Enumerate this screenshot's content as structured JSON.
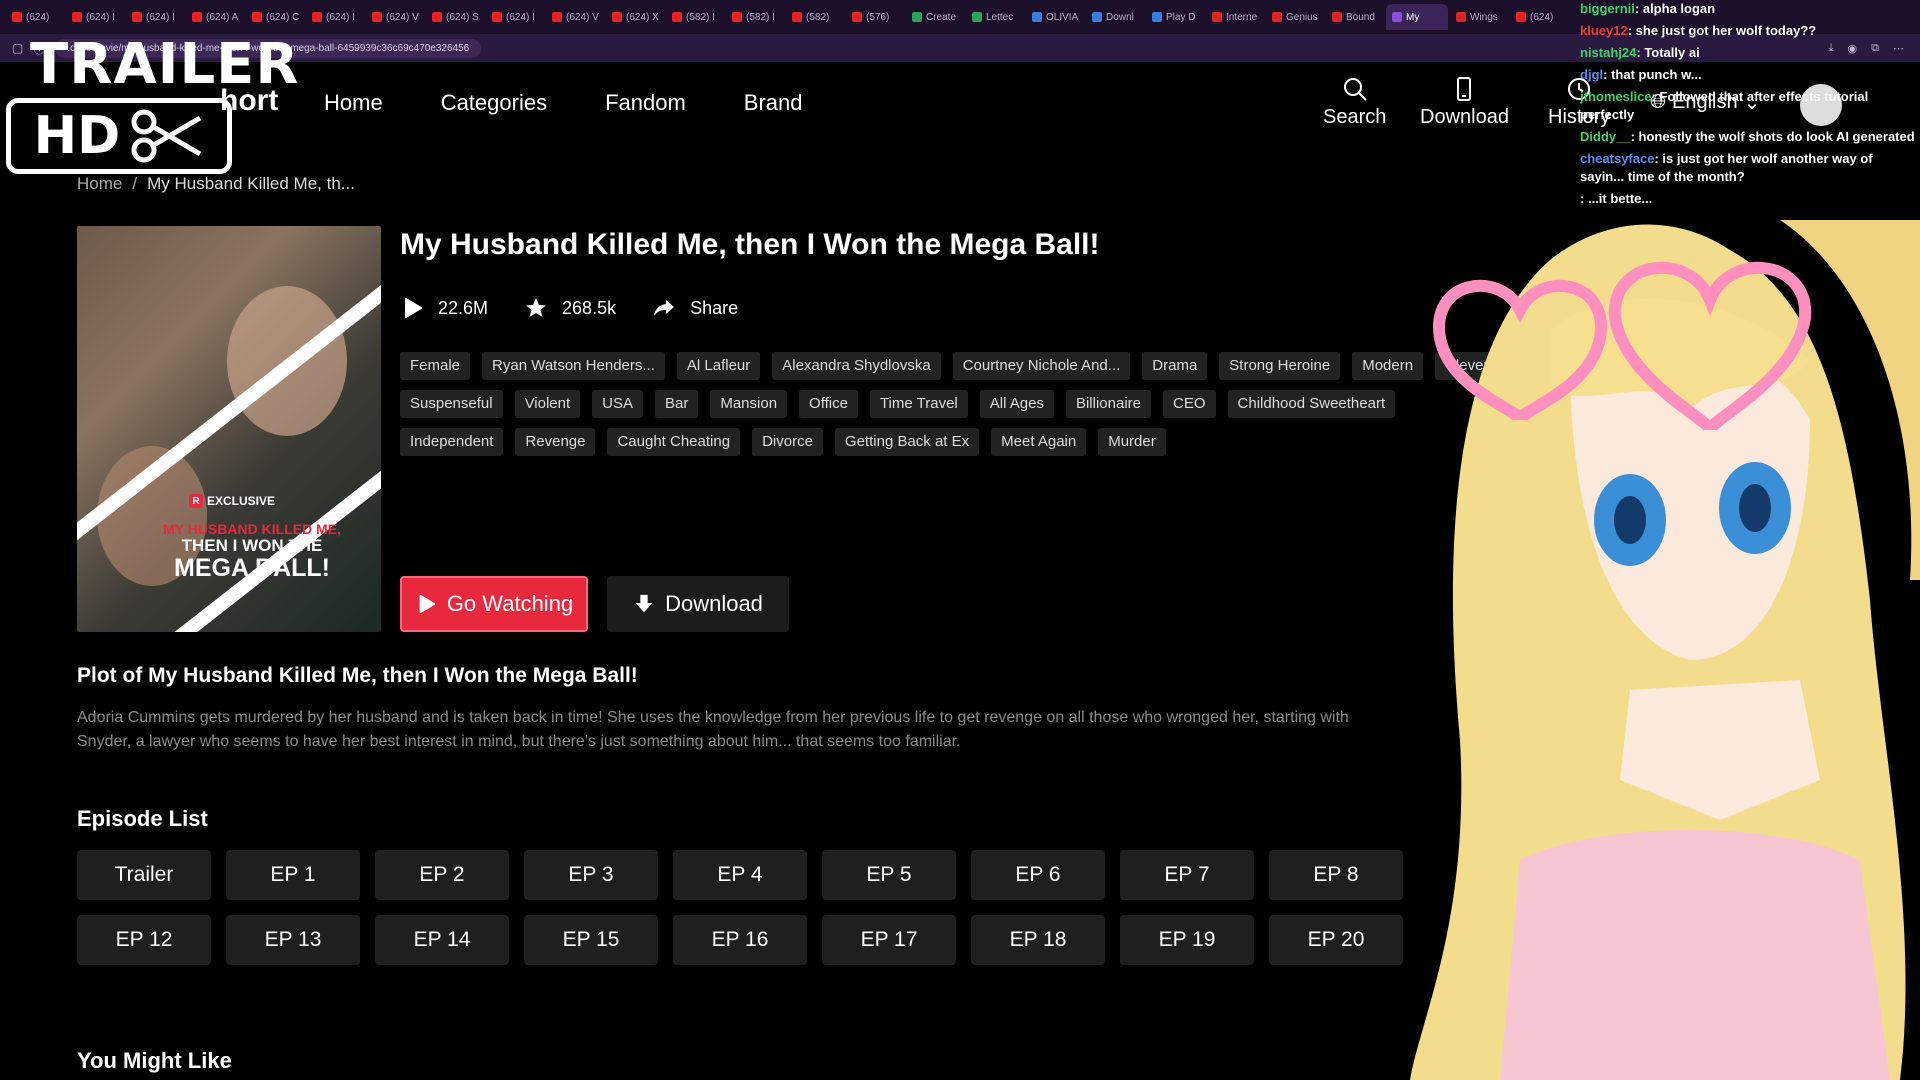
{
  "browser": {
    "tabs": [
      {
        "label": "(624) ",
        "favicon": "youtube",
        "active": false
      },
      {
        "label": "(624) I",
        "favicon": "youtube",
        "active": false
      },
      {
        "label": "(624) I",
        "favicon": "youtube",
        "active": false
      },
      {
        "label": "(624) A",
        "favicon": "youtube",
        "active": false
      },
      {
        "label": "(624) C",
        "favicon": "youtube",
        "active": false
      },
      {
        "label": "(624) I",
        "favicon": "youtube",
        "active": false
      },
      {
        "label": "(624) V",
        "favicon": "youtube",
        "active": false
      },
      {
        "label": "(624) S",
        "favicon": "youtube",
        "active": false
      },
      {
        "label": "(624) I",
        "favicon": "youtube",
        "active": false
      },
      {
        "label": "(624) V",
        "favicon": "youtube",
        "active": false
      },
      {
        "label": "(624) X",
        "favicon": "youtube",
        "active": false
      },
      {
        "label": "(582) I",
        "favicon": "youtube",
        "active": false
      },
      {
        "label": "(582) I",
        "favicon": "youtube",
        "active": false
      },
      {
        "label": "(582) ",
        "favicon": "youtube",
        "active": false
      },
      {
        "label": "(576) ",
        "favicon": "youtube",
        "active": false
      },
      {
        "label": "Create",
        "favicon": "green",
        "active": false
      },
      {
        "label": "Lettec",
        "favicon": "green",
        "active": false
      },
      {
        "label": "OLIVIA",
        "favicon": "blue",
        "active": false
      },
      {
        "label": "Downl",
        "favicon": "blue",
        "active": false
      },
      {
        "label": "Play D",
        "favicon": "blue",
        "active": false
      },
      {
        "label": "Interne",
        "favicon": "red2",
        "active": false
      },
      {
        "label": "Genius",
        "favicon": "red2",
        "active": false
      },
      {
        "label": "Bound",
        "favicon": "red2",
        "active": false
      },
      {
        "label": "My",
        "favicon": "purple",
        "active": true
      },
      {
        "label": "Wings",
        "favicon": "red2",
        "active": false
      },
      {
        "label": "(624)",
        "favicon": "youtube",
        "active": false
      }
    ],
    "url": ".com/movie/my-husband-killed-me-then-i-won-the-mega-ball-6459939c36c69c470e326456"
  },
  "logo": {
    "trailer": "TRAILER",
    "hd": "HD",
    "short": "hort"
  },
  "nav": {
    "home": "Home",
    "categories": "Categories",
    "fandom": "Fandom",
    "brand": "Brand"
  },
  "header_right": {
    "search": "Search",
    "download": "Download",
    "history": "History",
    "language": "English"
  },
  "breadcrumb": {
    "home": "Home",
    "separator": "/",
    "current": "My Husband Killed Me, th..."
  },
  "poster": {
    "badge": "EXCLUSIVE",
    "line1": "MY HUSBAND KILLED ME,",
    "line2": "THEN I WON THE",
    "line3": "MEGA BALL!"
  },
  "drama": {
    "title": "My Husband Killed Me, then I Won the Mega Ball!",
    "views": "22.6M",
    "favorites": "268.5k",
    "share": "Share",
    "tags": [
      "Female",
      "Ryan Watson Henders...",
      "Al Lafleur",
      "Alexandra Shydlovska",
      "Courtney Nichole And...",
      "Drama",
      "Strong Heroine",
      "Modern",
      "Clever",
      "Suspenseful",
      "Violent",
      "USA",
      "Bar",
      "Mansion",
      "Office",
      "Time Travel",
      "All Ages",
      "Billionaire",
      "CEO",
      "Childhood Sweetheart",
      "Independent",
      "Revenge",
      "Caught Cheating",
      "Divorce",
      "Getting Back at Ex",
      "Meet Again",
      "Murder"
    ],
    "watch_label": "Go Watching",
    "download_label": "Download",
    "plot_heading": "Plot of My Husband Killed Me, then I Won the Mega Ball!",
    "plot_line1": "Adoria Cummins gets murdered by her husband and is taken back in time! She uses the knowledge from her previous life to get revenge on all those who wronged her, starting with",
    "plot_line2": "Snyder, a lawyer who seems to have her best interest in mind, but there's just something about him... that seems too familiar."
  },
  "episodes": {
    "heading": "Episode List",
    "row1": [
      "Trailer",
      "EP 1",
      "EP 2",
      "EP 3",
      "EP 4",
      "EP 5",
      "EP 6",
      "EP 7",
      "EP 8"
    ],
    "row2": [
      "EP 12",
      "EP 13",
      "EP 14",
      "EP 15",
      "EP 16",
      "EP 17",
      "EP 18",
      "EP 19",
      "EP 20"
    ]
  },
  "you_might_like": "You Might Like",
  "chat": [
    {
      "user": "biggernii",
      "text": "alpha logan",
      "color": "#3ad16a"
    },
    {
      "user": "kluey12",
      "text": "she just got her wolf today??",
      "color": "#e83c3c"
    },
    {
      "user": "nistahj24",
      "text": "Totally ai",
      "color": "#3ad16a"
    },
    {
      "user": "djgl",
      "text": "that punch w...",
      "color": "#5a8df0"
    },
    {
      "user": "jthomeslice",
      "text": "Followed that after effects tutorial perfectly",
      "color": "#3ad16a"
    },
    {
      "user": "Diddy__",
      "text": "honestly the wolf shots do look AI generated",
      "color": "#3ad16a"
    },
    {
      "user": "cheatsyface",
      "text": "is just got her wolf another way of sayin... time of the month?",
      "color": "#5a8df0"
    },
    {
      "user": "",
      "text": "...it bette...",
      "color": "#5a8df0"
    }
  ],
  "colors": {
    "accent": "#e8283c",
    "tag_bg": "#222222",
    "episode_bg": "#1f1f1f",
    "plot_text": "#8a8a8a"
  }
}
